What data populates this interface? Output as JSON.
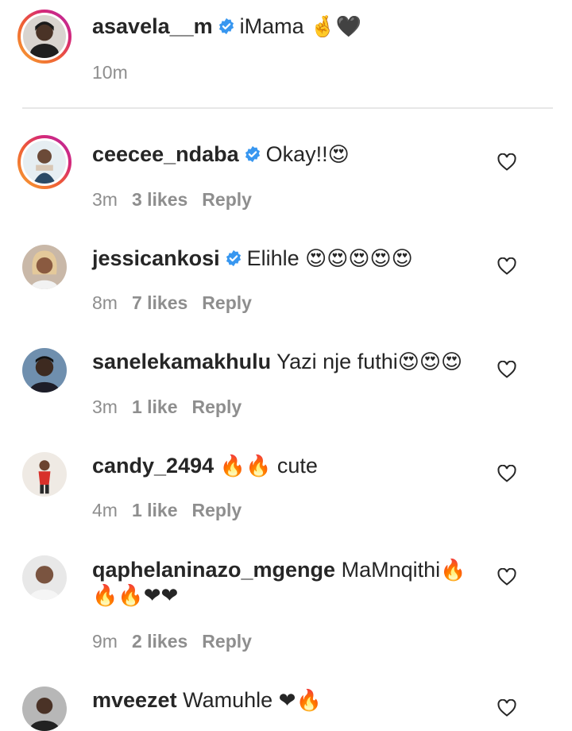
{
  "caption": {
    "username": "asavela__m",
    "text": "iMama",
    "emoji": "🤞🖤",
    "time": "10m"
  },
  "comments": [
    {
      "username": "ceecee_ndaba",
      "verified": true,
      "text": "Okay!!",
      "emoji": "😍",
      "time": "3m",
      "likes": "3 likes",
      "reply": "Reply"
    },
    {
      "username": "jessicankosi",
      "verified": true,
      "text": "Elihle ",
      "emoji": "😍😍😍😍😍",
      "time": "8m",
      "likes": "7 likes",
      "reply": "Reply"
    },
    {
      "username": "sanelekamakhulu",
      "verified": false,
      "text": "Yazi nje futhi",
      "emoji": "😍😍😍",
      "time": "3m",
      "likes": "1 like",
      "reply": "Reply"
    },
    {
      "username": "candy_2494",
      "verified": false,
      "text": "cute",
      "emoji": "🔥🔥",
      "time": "4m",
      "likes": "1 like",
      "reply": "Reply"
    },
    {
      "username": "qaphelaninazo_mgenge",
      "verified": false,
      "text": "MaMnqithi",
      "emoji": "🔥",
      "emoji_line2": "🔥🔥❤❤",
      "time": "9m",
      "likes": "2 likes",
      "reply": "Reply"
    },
    {
      "username": "mveezet",
      "verified": false,
      "text": "Wamuhle",
      "emoji": "❤🔥"
    }
  ],
  "colors": {
    "verified": "#3897f0",
    "muted": "#8e8e8e",
    "text": "#262626"
  },
  "icons": {
    "verified": "verified-badge-icon",
    "like": "heart-outline-icon"
  }
}
